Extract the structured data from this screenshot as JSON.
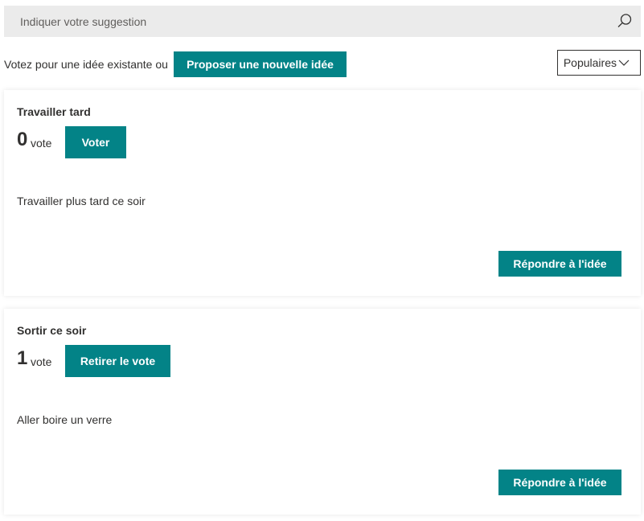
{
  "search": {
    "placeholder": "Indiquer votre suggestion",
    "value": ""
  },
  "toolbar": {
    "vote_prompt": "Votez pour une idée existante ou",
    "new_idea_label": "Proposer une nouvelle idée",
    "sort_label": "Populaires"
  },
  "ideas": [
    {
      "title": "Travailler tard",
      "votes": "0",
      "vote_unit": "vote",
      "vote_button": "Voter",
      "description": "Travailler plus tard ce soir",
      "reply_button": "Répondre à l'idée"
    },
    {
      "title": "Sortir ce soir",
      "votes": "1",
      "vote_unit": "vote",
      "vote_button": "Retirer le vote",
      "description": "Aller boire un verre",
      "reply_button": "Répondre à l'idée"
    }
  ],
  "colors": {
    "accent": "#038387",
    "search_bg": "#ebebeb",
    "text": "#323130"
  },
  "icons": {
    "search": "search-icon",
    "sort": "chevron-down-icon"
  }
}
